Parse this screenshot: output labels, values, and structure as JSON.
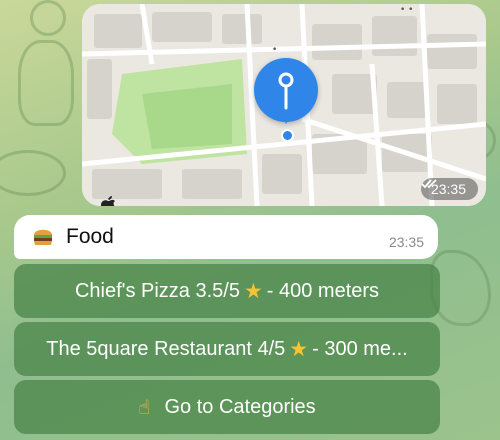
{
  "map_message": {
    "time": "23:35",
    "status_icon": "double-check-icon",
    "attribution": ""
  },
  "food_message": {
    "emoji": "hamburger-icon",
    "text": "Food",
    "time": "23:35"
  },
  "buttons": [
    {
      "label": "Chief's Pizza 3.5/5",
      "suffix": " - 400 meters",
      "icon": "star-icon"
    },
    {
      "label": "The 5quare Restaurant 4/5",
      "suffix": " - 300 me...",
      "icon": "star-icon"
    },
    {
      "label": "Go to Categories",
      "icon": "pointing-hand-icon"
    }
  ],
  "colors": {
    "pin": "#2f86e8",
    "button_bg": "#4f8f52",
    "bubble": "#ffffff"
  }
}
